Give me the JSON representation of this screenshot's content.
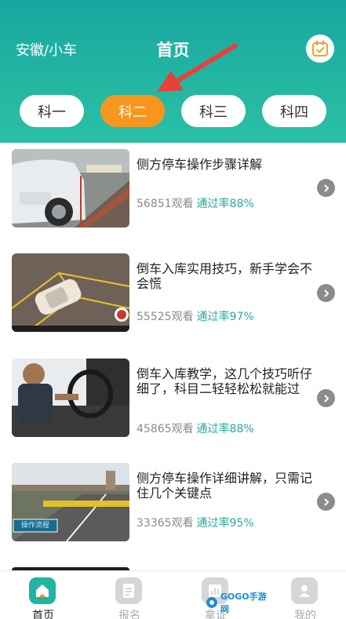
{
  "header": {
    "location": "安徽/小车",
    "title": "首页",
    "calendar_icon": "calendar-check-icon",
    "tabs": [
      {
        "label": "科一",
        "active": false
      },
      {
        "label": "科二",
        "active": true
      },
      {
        "label": "科三",
        "active": false
      },
      {
        "label": "科四",
        "active": false
      }
    ],
    "accent_color": "#f7961e",
    "brand_color": "#1fb0a2"
  },
  "videos": [
    {
      "title": "侧方停车操作步骤详解",
      "views": "56851观看",
      "pass_rate": "通过率88%"
    },
    {
      "title": "倒车入库实用技巧，新手学会不会慌",
      "views": "55525观看",
      "pass_rate": "通过率97%"
    },
    {
      "title": "倒车入库教学，这几个技巧听仔细了，科目二轻轻松松就能过",
      "views": "45865观看",
      "pass_rate": "通过率88%"
    },
    {
      "title": "侧方停车操作详细讲解，只需记住几个关键点",
      "views": "33365观看",
      "pass_rate": "通过率95%",
      "thumb_caption": "操作流程"
    }
  ],
  "tabbar": [
    {
      "label": "首页",
      "icon": "home-icon",
      "active": true
    },
    {
      "label": "报名",
      "icon": "document-icon",
      "active": false
    },
    {
      "label": "拿证",
      "icon": "chart-icon",
      "active": false
    },
    {
      "label": "我的",
      "icon": "user-icon",
      "active": false
    }
  ],
  "watermark": "GOGO手游网"
}
